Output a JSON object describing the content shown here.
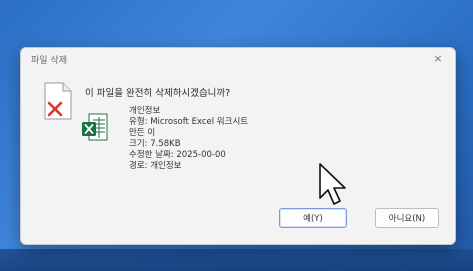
{
  "dialog": {
    "title": "파일 삭제",
    "close_glyph": "×",
    "question": "이 파일을 완전히 삭제하시겠습니까?",
    "file": {
      "name": "개인정보",
      "type": "유형: Microsoft Excel 워크시트",
      "author": "만든 이",
      "size": "크기: 7.58KB",
      "modified": "수정한 날짜: 2025-00-00",
      "path": "경로: 개인정보"
    },
    "buttons": {
      "yes": "예(Y)",
      "no": "아니요(N)"
    }
  },
  "colors": {
    "desktop": "#2a6fc4",
    "excel_green": "#1e7145",
    "delete_red": "#d9342b"
  },
  "icons": [
    "delete-file-icon",
    "excel-file-icon",
    "close-icon",
    "mouse-pointer-icon"
  ]
}
